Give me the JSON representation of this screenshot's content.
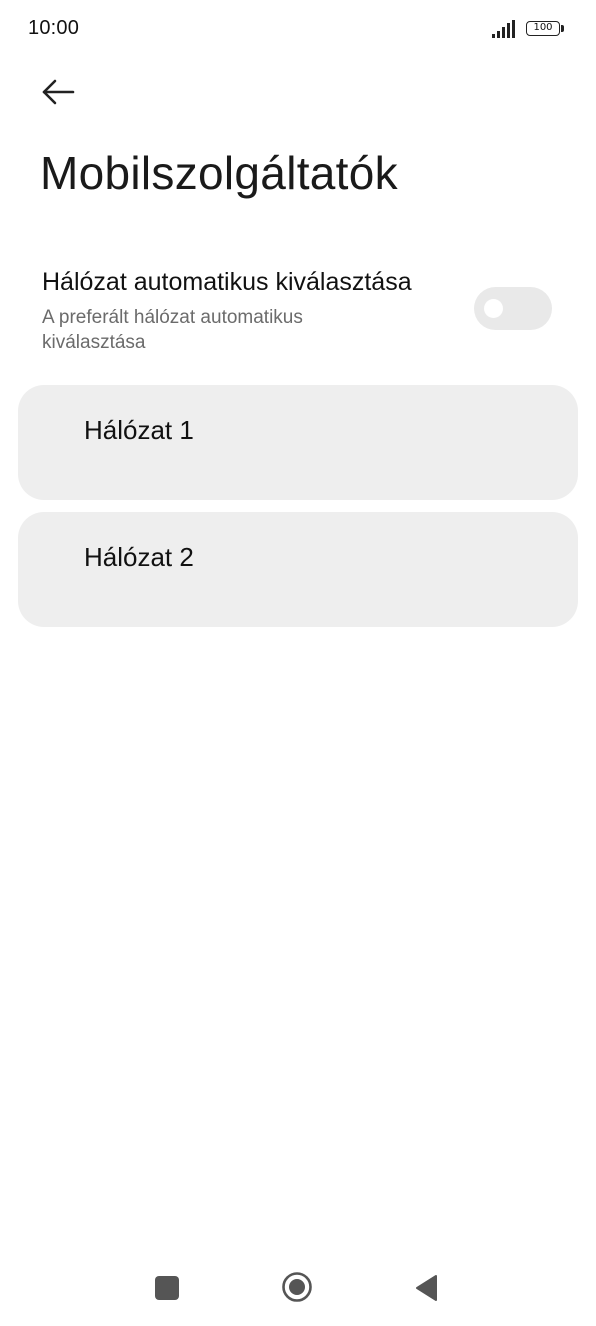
{
  "status_bar": {
    "time": "10:00",
    "battery_level": "100",
    "icons": [
      "signal-icon",
      "battery-icon"
    ]
  },
  "header": {
    "back_icon": "arrow-left-icon",
    "title": "Mobilszolgáltatók"
  },
  "auto_select": {
    "title": "Hálózat automatikus kiválasztása",
    "subtitle": "A preferált hálózat automatikus kiválasztása",
    "toggle_on": false
  },
  "networks": [
    {
      "label": "Hálózat 1"
    },
    {
      "label": "Hálózat 2"
    }
  ],
  "nav_bar": {
    "icons": [
      "recent-apps-icon",
      "home-icon",
      "back-triangle-icon"
    ]
  },
  "colors": {
    "card_background": "#eeeeee",
    "toggle_off": "#e9e9e9",
    "subtitle_text": "#6b6b6b"
  }
}
